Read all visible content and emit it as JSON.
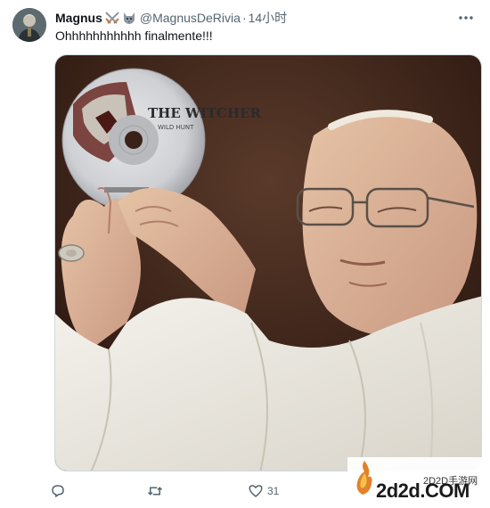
{
  "tweet": {
    "author": {
      "display_name": "Magnus",
      "emoji_icons": [
        "crossed-swords-icon",
        "wolf-icon"
      ],
      "handle": "@MagnusDeRivia",
      "separator": "·",
      "time": "14小时"
    },
    "text": "Ohhhhhhhhhhh finalmente!!!",
    "media": {
      "disc_title": "THE WITCHER",
      "disc_subtitle": "WILD HUNT"
    },
    "actions": {
      "reply": {
        "icon": "reply-icon",
        "count": ""
      },
      "retweet": {
        "icon": "retweet-icon",
        "count": ""
      },
      "like": {
        "icon": "heart-icon",
        "count": "31"
      }
    }
  },
  "watermark": {
    "small_text": "2D2D手游网",
    "brand_text": "2d2d.COM"
  },
  "colors": {
    "text_primary": "#0f1419",
    "text_secondary": "#536471",
    "border": "#cfd9de"
  }
}
